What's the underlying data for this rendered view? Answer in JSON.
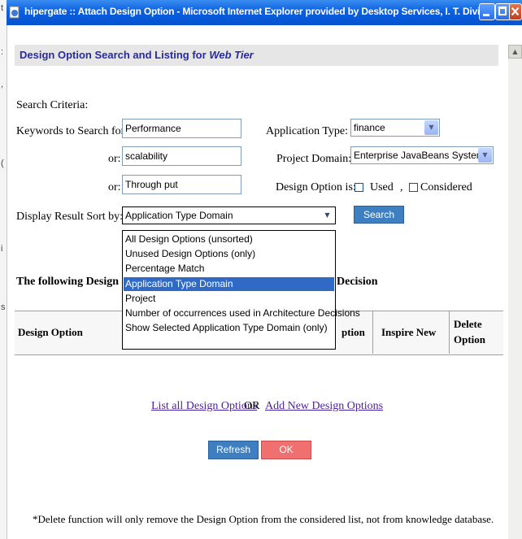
{
  "window": {
    "title": "hipergate :: Attach Design Option - Microsoft Internet Explorer provided by Desktop Services, I. T. Division"
  },
  "page": {
    "heading_prefix": "Design Option Search and Listing for",
    "heading_tier": "Web Tier"
  },
  "search": {
    "criteria_label": "Search Criteria:",
    "keywords_label": "Keywords to Search for:",
    "or_label": "or:",
    "keyword1": "Performance",
    "keyword2": "scalability",
    "keyword3": "Through put",
    "application_type_label": "Application Type:",
    "application_type_value": "finance",
    "project_domain_label": "Project Domain:",
    "project_domain_value": "Enterprise JavaBeans System",
    "design_option_is_label": "Design Option is:",
    "used_label": "Used",
    "comma": ",",
    "considered_label": "Considered",
    "sort_by_label": "Display Result Sort by:",
    "sort_by_value": "Application Type Domain",
    "search_button": "Search"
  },
  "sort_options": [
    "All Design Options (unsorted)",
    "Unused Design Options (only)",
    "Percentage Match",
    "Application Type Domain",
    "Project",
    "Number of occurrences used in Architecture Decisions",
    "Show Selected Application Type Domain (only)"
  ],
  "sort_selected_index": 3,
  "results": {
    "intro_left": "The following Design Opt",
    "intro_right": "Decision",
    "columns": {
      "design_option": "Design Option",
      "option": "ption",
      "inspire_new": "Inspire New",
      "delete_option_1": "Delete",
      "delete_option_2": "Option"
    }
  },
  "links": {
    "list_all": "List all Design Options",
    "or_text": "OR",
    "add_new": "Add New Design Options"
  },
  "buttons": {
    "refresh": "Refresh",
    "ok": "OK"
  },
  "footnote": "*Delete function will only remove the Design Option from the considered list, not from knowledge database.",
  "colors": {
    "titlebar": "#0a5fe0",
    "heading_text": "#2a2aa0",
    "selected_item": "#316ac5",
    "link": "#4a1fa0",
    "button_blue": "#3d7fc1",
    "button_red": "#f07070"
  }
}
